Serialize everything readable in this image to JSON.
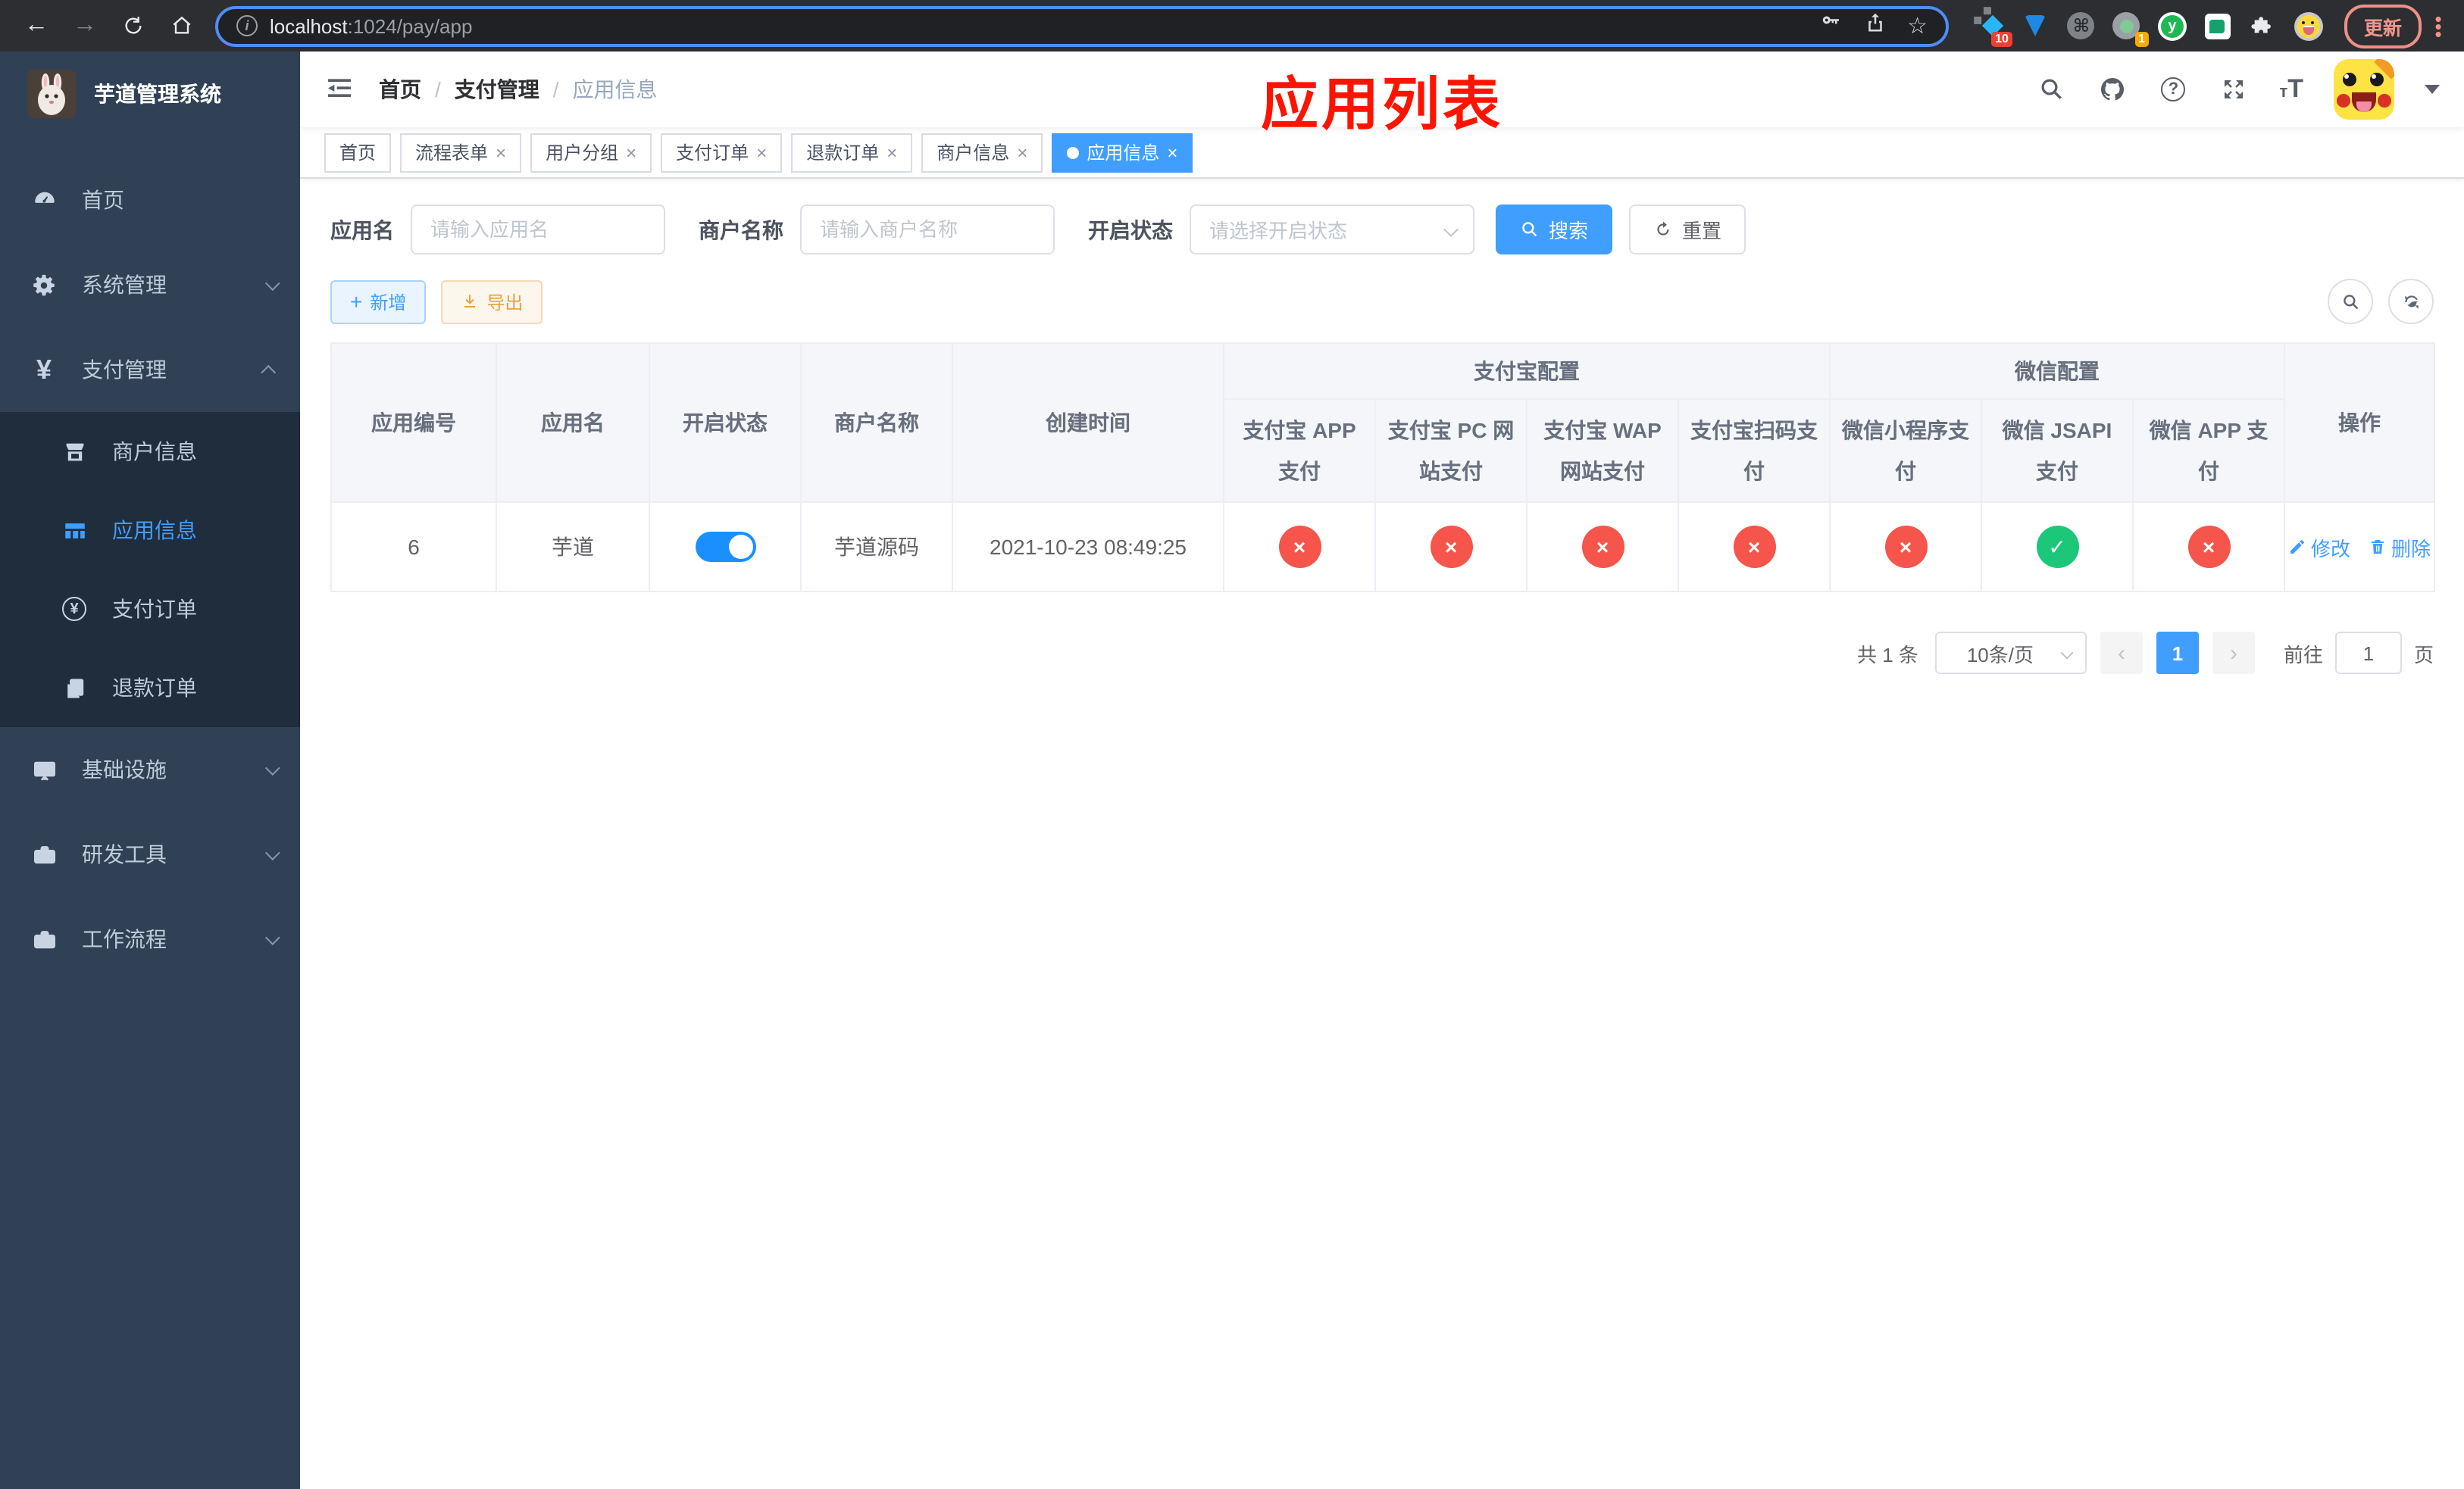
{
  "browser": {
    "url_host": "localhost",
    "url_rest": ":1024/pay/app",
    "ext_badge_primary": "10",
    "ext_badge_secondary": "1",
    "ext_y_letter": "y",
    "update_label": "更新"
  },
  "sidebar": {
    "title": "芋道管理系统",
    "items": [
      {
        "label": "首页"
      },
      {
        "label": "系统管理"
      },
      {
        "label": "支付管理"
      },
      {
        "label": "商户信息"
      },
      {
        "label": "应用信息"
      },
      {
        "label": "支付订单"
      },
      {
        "label": "退款订单"
      },
      {
        "label": "基础设施"
      },
      {
        "label": "研发工具"
      },
      {
        "label": "工作流程"
      }
    ]
  },
  "breadcrumb": {
    "home": "首页",
    "section": "支付管理",
    "current": "应用信息",
    "sep": "/"
  },
  "annotation": "应用列表",
  "tabs": [
    {
      "label": "首页"
    },
    {
      "label": "流程表单"
    },
    {
      "label": "用户分组"
    },
    {
      "label": "支付订单"
    },
    {
      "label": "退款订单"
    },
    {
      "label": "商户信息"
    },
    {
      "label": "应用信息"
    }
  ],
  "filters": {
    "app_name_label": "应用名",
    "app_name_placeholder": "请输入应用名",
    "merchant_label": "商户名称",
    "merchant_placeholder": "请输入商户名称",
    "status_label": "开启状态",
    "status_placeholder": "请选择开启状态",
    "search_label": "搜索",
    "reset_label": "重置"
  },
  "toolbar": {
    "add_label": "新增",
    "export_label": "导出"
  },
  "table": {
    "headers": {
      "app_id": "应用编号",
      "app_name": "应用名",
      "status": "开启状态",
      "merchant": "商户名称",
      "created": "创建时间",
      "alipay_group": "支付宝配置",
      "wechat_group": "微信配置",
      "action": "操作",
      "channels": [
        "支付宝 APP 支付",
        "支付宝 PC 网站支付",
        "支付宝 WAP 网站支付",
        "支付宝扫码支付",
        "微信小程序支付",
        "微信 JSAPI 支付",
        "微信 APP 支付"
      ]
    },
    "row": {
      "app_id": "6",
      "app_name": "芋道",
      "merchant": "芋道源码",
      "created": "2021-10-23 08:49:25",
      "channels": [
        "no",
        "no",
        "no",
        "no",
        "no",
        "yes",
        "no"
      ],
      "edit_label": "修改",
      "delete_label": "删除"
    }
  },
  "pagination": {
    "total": "共 1 条",
    "page_size": "10条/页",
    "prev": "‹",
    "page": "1",
    "next": "›",
    "goto_label": "前往",
    "goto_value": "1",
    "unit_label": "页"
  },
  "colors": {
    "primary": "#409eff",
    "danger": "#f5554a",
    "success": "#1dc779",
    "warning": "#e6a23c",
    "sidebar_bg": "#304156",
    "annotation": "#fd1400"
  }
}
